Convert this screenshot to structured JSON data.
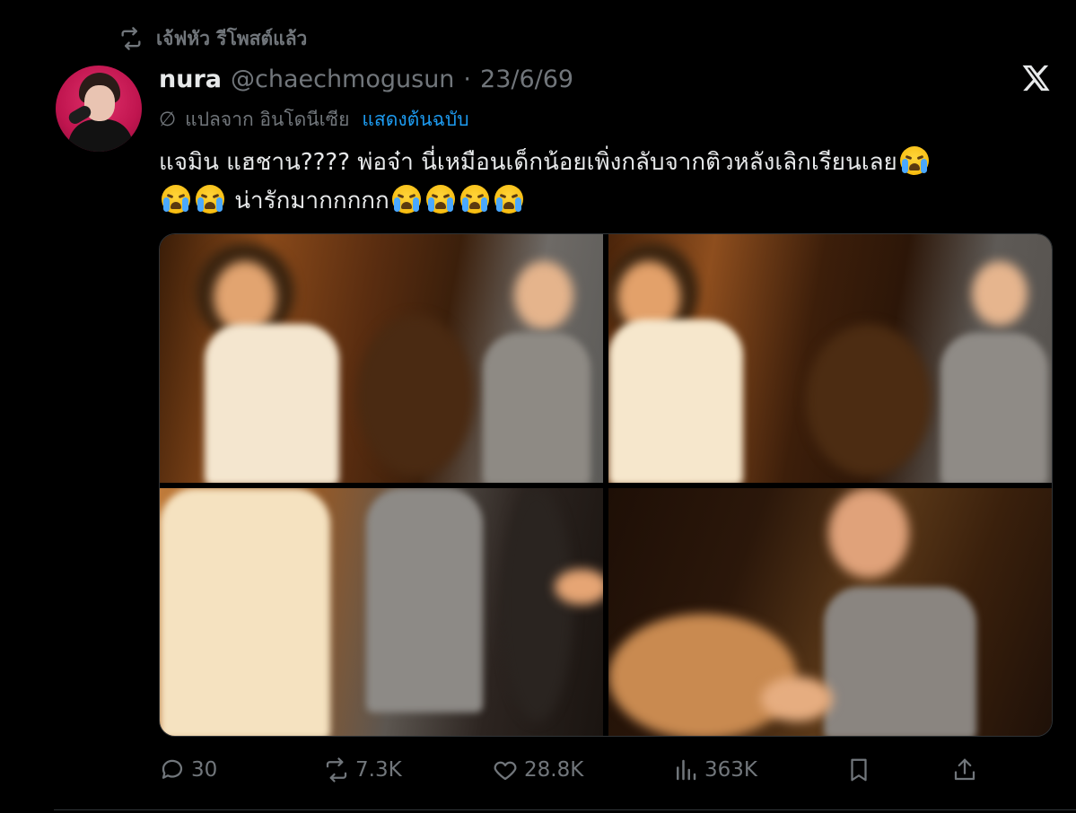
{
  "repost": {
    "text": "เจ้ฟหัว รีโพสต์แล้ว",
    "icon": "repost-icon"
  },
  "author": {
    "name": "nura",
    "handle": "@chaechmogusun",
    "separator": "·",
    "date": "23/6/69"
  },
  "translation": {
    "icon": "translate-icon",
    "from_label": "แปลจาก อินโดนีเซีย",
    "show_original": "แสดงต้นฉบับ"
  },
  "body": {
    "line1": "แจมิน แฮชาน???? พ่อจ๋า นี่เหมือนเด็กน้อยเพิ่งกลับจากติวหลังเลิกเรียนเลย",
    "line2": "น่ารักมากกกกก",
    "emoji": "loudly-crying-face"
  },
  "media": {
    "count": 4
  },
  "actions": {
    "replies": "30",
    "reposts": "7.3K",
    "likes": "28.8K",
    "views": "363K"
  },
  "colors": {
    "background": "#000000",
    "text": "#e7e9ea",
    "secondary": "#71767b",
    "link": "#1d9bf0",
    "border": "#2f3336"
  }
}
